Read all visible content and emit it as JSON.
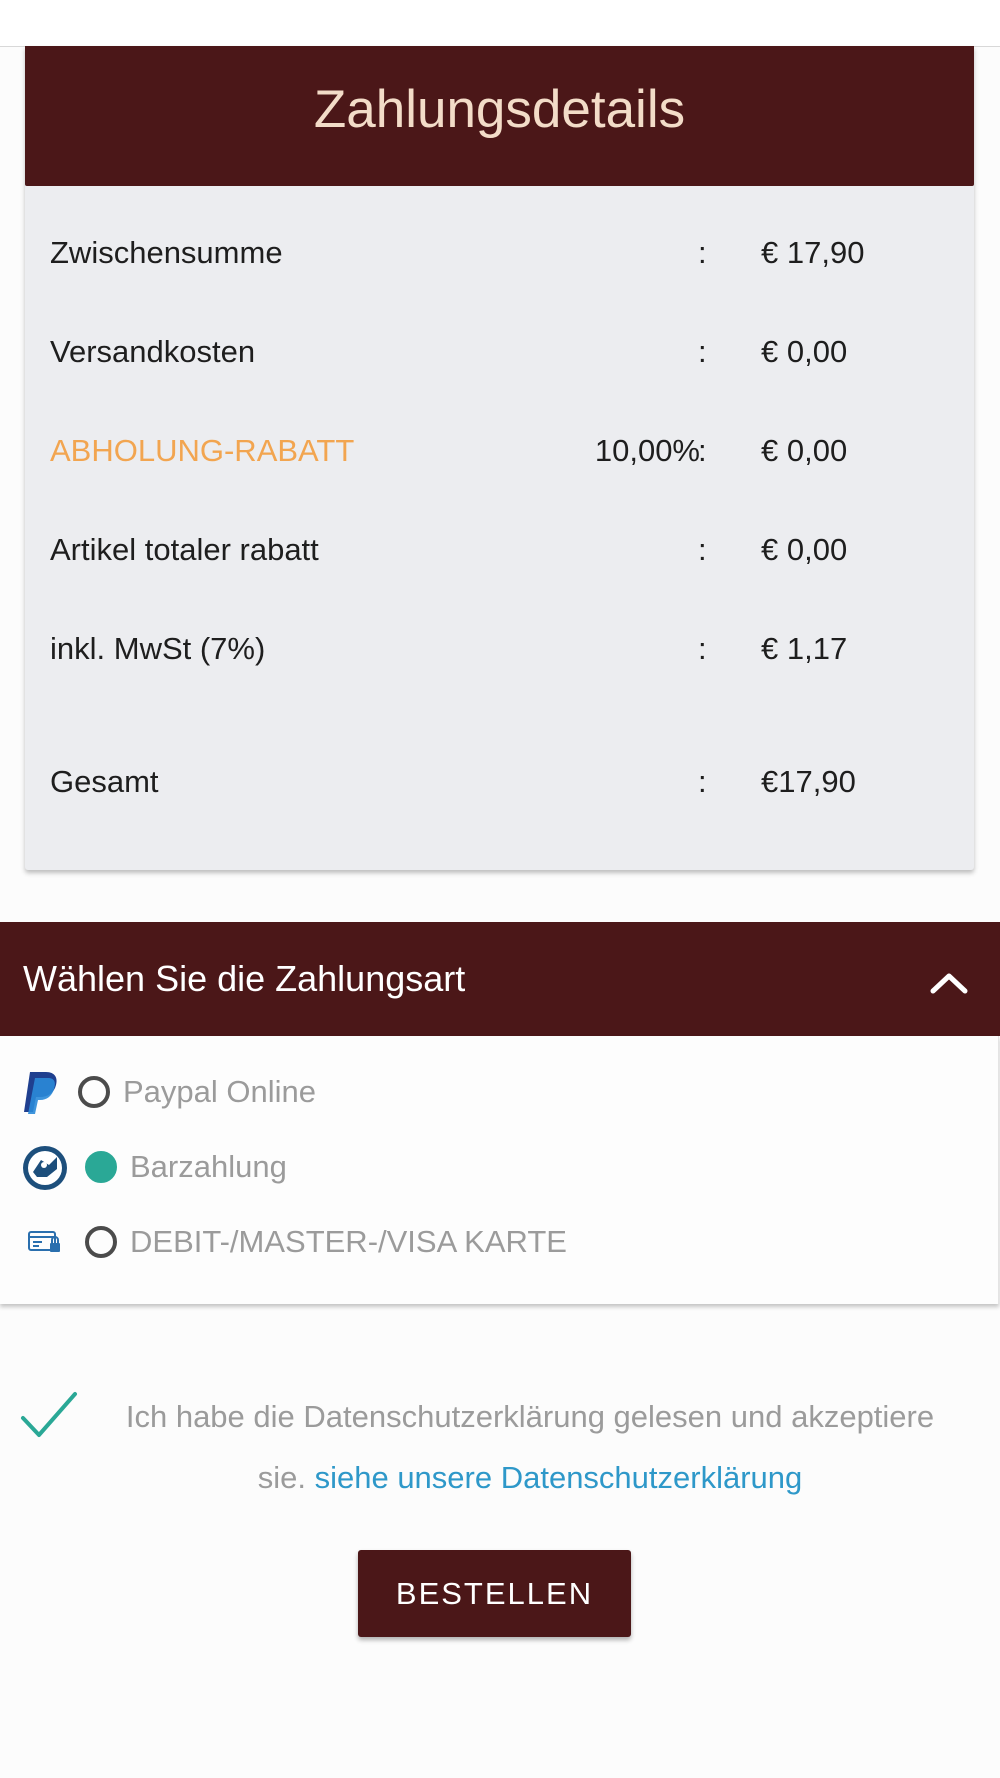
{
  "payment_details": {
    "title": "Zahlungsdetails",
    "rows": [
      {
        "label": "Zwischensumme",
        "percent": "",
        "separator": ":",
        "value": "€ 17,90"
      },
      {
        "label": "Versandkosten",
        "percent": "",
        "separator": ":",
        "value": "€ 0,00"
      },
      {
        "label": "ABHOLUNG-RABATT",
        "percent": "10,00%",
        "separator": ":",
        "value": "€ 0,00"
      },
      {
        "label": "Artikel totaler rabatt",
        "percent": "",
        "separator": ":",
        "value": "€ 0,00"
      },
      {
        "label": "inkl. MwSt (7%)",
        "percent": "",
        "separator": ":",
        "value": "€ 1,17"
      },
      {
        "label": "Gesamt",
        "percent": "",
        "separator": ":",
        "value": "€17,90"
      }
    ]
  },
  "payment_method": {
    "title": "Wählen Sie die Zahlungsart",
    "collapse_icon": "chevron-up-icon",
    "options": [
      {
        "label": "Paypal Online",
        "icon": "paypal-icon",
        "selected": false
      },
      {
        "label": "Barzahlung",
        "icon": "cash-icon",
        "selected": true
      },
      {
        "label": "DEBIT-/MASTER-/VISA KARTE",
        "icon": "credit-card-icon",
        "selected": false
      }
    ]
  },
  "consent": {
    "text": "Ich habe die Datenschutzerklärung gelesen und akzeptiere sie.",
    "link": "siehe unsere Datenschutzerklärung",
    "checked": true
  },
  "order_button": {
    "label": "BESTELLEN"
  },
  "colors": {
    "brand": "#4b1718",
    "accent_orange": "#f2a550",
    "selected_radio": "#2aa896",
    "link": "#2e98c9"
  }
}
